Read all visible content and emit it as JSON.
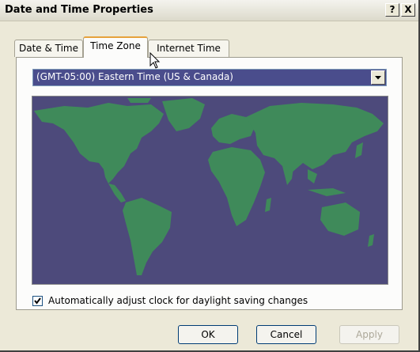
{
  "window": {
    "title": "Date and Time Properties",
    "help_label": "?",
    "close_label": "X"
  },
  "tabs": [
    {
      "label": "Date & Time",
      "active": false
    },
    {
      "label": "Time Zone",
      "active": true
    },
    {
      "label": "Internet Time",
      "active": false
    }
  ],
  "timezone": {
    "selected": "(GMT-05:00) Eastern Time (US & Canada)"
  },
  "map": {
    "ocean_color": "#4d4a7b",
    "land_color": "#3f8a5a"
  },
  "daylight": {
    "label": "Automatically adjust clock for daylight saving changes",
    "checked": true
  },
  "buttons": {
    "ok": "OK",
    "cancel": "Cancel",
    "apply": "Apply"
  }
}
